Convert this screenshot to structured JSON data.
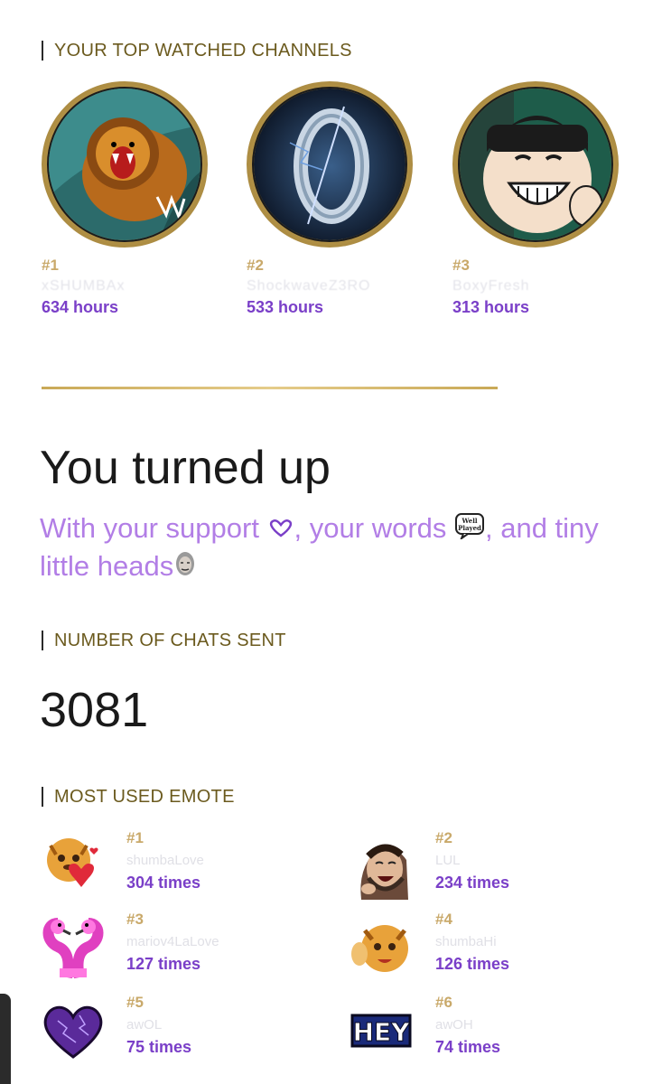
{
  "top_channels": {
    "label": "YOUR TOP WATCHED CHANNELS",
    "items": [
      {
        "rank": "#1",
        "name": "xSHUMBAx",
        "hours": "634 hours",
        "avatar_icon": "lion-avatar-icon"
      },
      {
        "rank": "#2",
        "name": "ShockwaveZ3RO",
        "hours": "533 hours",
        "avatar_icon": "zero-logo-avatar-icon"
      },
      {
        "rank": "#3",
        "name": "BoxyFresh",
        "hours": "313 hours",
        "avatar_icon": "cartoon-face-avatar-icon"
      }
    ]
  },
  "turned_up": {
    "title": "You turned up",
    "part1": "With your support ",
    "part2": ", your words ",
    "part3": ", and tiny little heads",
    "emote_support": "heart-hands-icon",
    "emote_words": "well-played-icon",
    "emote_heads": "kappa-head-icon"
  },
  "chats": {
    "label": "NUMBER OF CHATS SENT",
    "value": "3081"
  },
  "emotes": {
    "label": "MOST USED EMOTE",
    "items": [
      {
        "rank": "#1",
        "name": "shumbaLove",
        "count": "304 times",
        "icon": "lion-love-emote-icon"
      },
      {
        "rank": "#2",
        "name": "LUL",
        "count": "234 times",
        "icon": "lul-emote-icon"
      },
      {
        "rank": "#3",
        "name": "mariov4LaLove",
        "count": "127 times",
        "icon": "flamingo-love-emote-icon"
      },
      {
        "rank": "#4",
        "name": "shumbaHi",
        "count": "126 times",
        "icon": "lion-hi-emote-icon"
      },
      {
        "rank": "#5",
        "name": "awOL",
        "count": "75 times",
        "icon": "purple-heart-emote-icon"
      },
      {
        "rank": "#6",
        "name": "awOH",
        "count": "74 times",
        "icon": "hey-emote-icon"
      }
    ]
  },
  "colors": {
    "gold": "#c9a957",
    "label_text": "#6b5a1e",
    "accent_purple": "#7a3fc8",
    "soft_purple": "#b27ee6"
  }
}
